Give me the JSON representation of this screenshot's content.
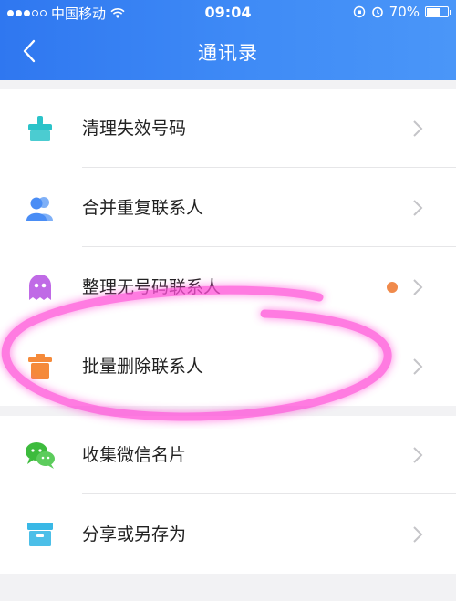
{
  "status_bar": {
    "carrier": "中国移动",
    "time": "09:04",
    "battery": "70%",
    "battery_level": 0.7
  },
  "header": {
    "title": "通讯录",
    "back_icon": "chevron-left-icon"
  },
  "sections": [
    {
      "items": [
        {
          "label": "清理失效号码",
          "icon": "broom-icon",
          "icon_color": "#2bc3c9"
        },
        {
          "label": "合并重复联系人",
          "icon": "users-icon",
          "icon_color": "#4a8df5"
        },
        {
          "label": "整理无号码联系人",
          "icon": "ghost-icon",
          "icon_color": "#c06ae6",
          "badge": true,
          "badge_color": "#f08a4b"
        },
        {
          "label": "批量删除联系人",
          "icon": "trash-icon",
          "icon_color": "#f58a3a"
        }
      ]
    },
    {
      "items": [
        {
          "label": "收集微信名片",
          "icon": "wechat-icon",
          "icon_color": "#3dbb3d"
        },
        {
          "label": "分享或另存为",
          "icon": "archive-box-icon",
          "icon_color": "#39b8e6"
        }
      ]
    }
  ],
  "colors": {
    "header_gradient_start": "#2f77f0",
    "header_gradient_end": "#4a96f8",
    "annotation": "#ff4fd8"
  }
}
